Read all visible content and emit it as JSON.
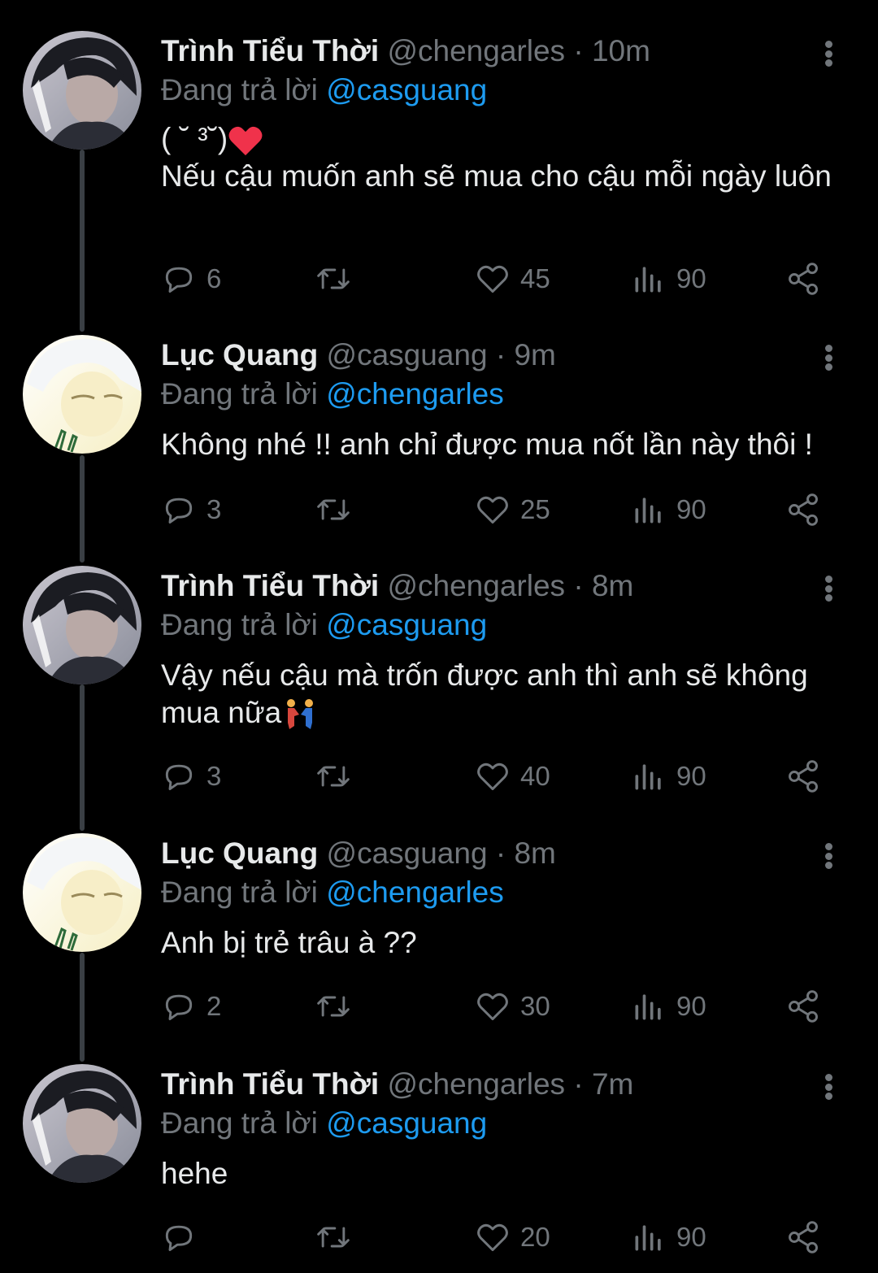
{
  "tweets": [
    {
      "name": "Trình Tiểu Thời",
      "handle": "@chengarles",
      "time": "10m",
      "reply_prefix": "Đang trả lời",
      "reply_to": "@casguang",
      "text_line1": "( ˘ ³˘)",
      "text_line2": "Nếu cậu muốn anh sẽ mua cho cậu mỗi ngày luôn",
      "replies": "6",
      "likes": "45",
      "views": "90"
    },
    {
      "name": "Lục Quang",
      "handle": "@casguang",
      "time": "9m",
      "reply_prefix": "Đang trả lời",
      "reply_to": "@chengarles",
      "text": "Không nhé !! anh chỉ được mua nốt lần này thôi !",
      "replies": "3",
      "likes": "25",
      "views": "90"
    },
    {
      "name": "Trình Tiểu Thời",
      "handle": "@chengarles",
      "time": "8m",
      "reply_prefix": "Đang trả lời",
      "reply_to": "@casguang",
      "text": "Vậy nếu cậu mà trốn được anh thì anh sẽ không mua nữa",
      "replies": "3",
      "likes": "40",
      "views": "90"
    },
    {
      "name": "Lục Quang",
      "handle": "@casguang",
      "time": "8m",
      "reply_prefix": "Đang trả lời",
      "reply_to": "@chengarles",
      "text": "Anh bị trẻ trâu à ??",
      "replies": "2",
      "likes": "30",
      "views": "90"
    },
    {
      "name": "Trình Tiểu Thời",
      "handle": "@chengarles",
      "time": "7m",
      "reply_prefix": "Đang trả lời",
      "reply_to": "@casguang",
      "text": "hehe",
      "replies": "",
      "likes": "20",
      "views": "90"
    }
  ],
  "separator": "·",
  "icons": {
    "reply": "reply-icon",
    "retweet": "retweet-icon",
    "like": "heart-icon",
    "views": "views-icon",
    "share": "share-icon",
    "more": "more-vertical-icon"
  },
  "colors": {
    "background": "#000000",
    "text": "#e7e9ea",
    "muted": "#71767b",
    "mention": "#1d9bf0",
    "thread_line": "#3a3f44"
  }
}
